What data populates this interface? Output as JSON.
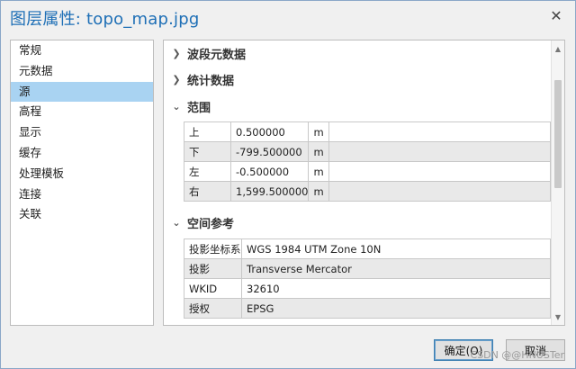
{
  "window": {
    "title": "图层属性: topo_map.jpg"
  },
  "sidebar": {
    "items": [
      {
        "label": "常规"
      },
      {
        "label": "元数据"
      },
      {
        "label": "源"
      },
      {
        "label": "高程"
      },
      {
        "label": "显示"
      },
      {
        "label": "缓存"
      },
      {
        "label": "处理模板"
      },
      {
        "label": "连接"
      },
      {
        "label": "关联"
      }
    ],
    "selected": "源"
  },
  "sections": {
    "band_metadata": {
      "label": "波段元数据",
      "expanded": false
    },
    "statistics": {
      "label": "统计数据",
      "expanded": false
    },
    "extent": {
      "label": "范围",
      "expanded": true,
      "rows": [
        {
          "key": "上",
          "value": "0.500000",
          "unit": "m"
        },
        {
          "key": "下",
          "value": "-799.500000",
          "unit": "m"
        },
        {
          "key": "左",
          "value": "-0.500000",
          "unit": "m"
        },
        {
          "key": "右",
          "value": "1,599.500000",
          "unit": "m"
        }
      ]
    },
    "spatial_ref": {
      "label": "空间参考",
      "expanded": true,
      "rows": [
        {
          "key": "投影坐标系",
          "value": "WGS 1984 UTM Zone 10N"
        },
        {
          "key": "投影",
          "value": "Transverse Mercator"
        },
        {
          "key": "WKID",
          "value": "32610"
        },
        {
          "key": "授权",
          "value": "EPSG"
        }
      ]
    }
  },
  "buttons": {
    "ok": "确定(O)",
    "cancel": "取消"
  },
  "watermark": "CSDN @@HNUSTer",
  "icons": {
    "close": "close-icon",
    "expand": "chevron-right-icon",
    "collapse": "chevron-down-icon"
  },
  "colors": {
    "title": "#1e6fb6",
    "selected": "#a9d3f2"
  }
}
